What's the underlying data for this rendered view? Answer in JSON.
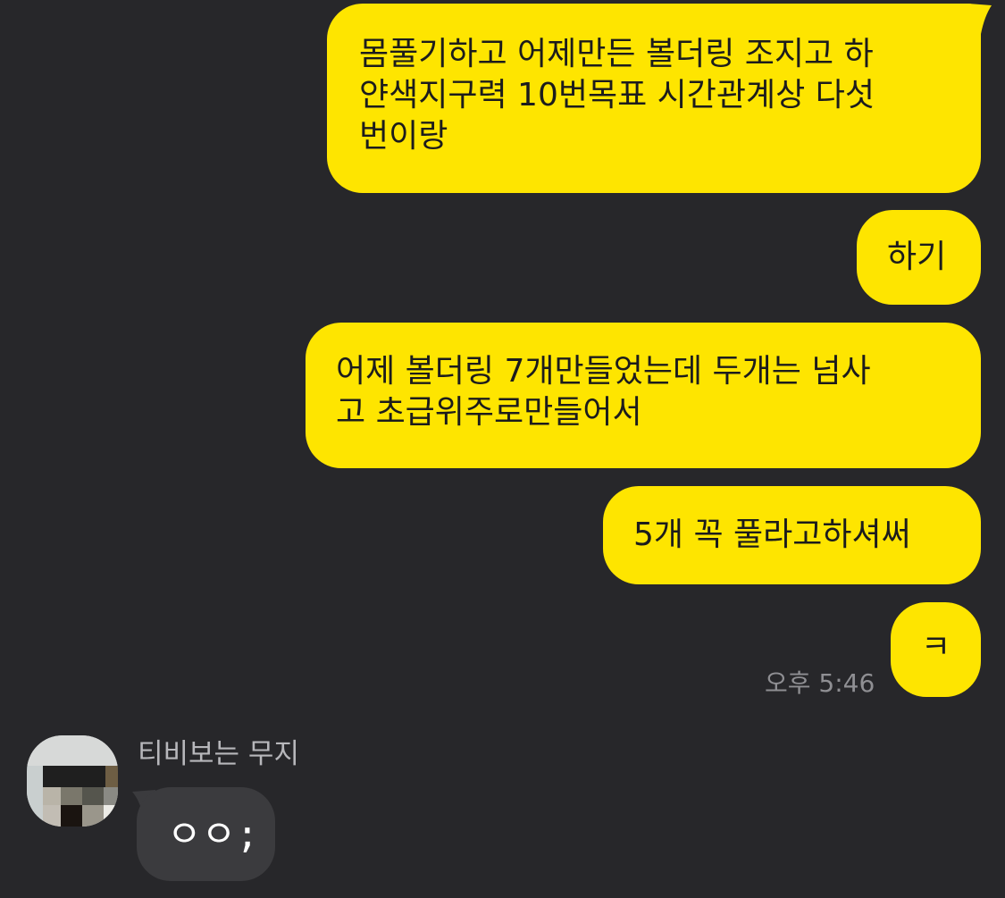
{
  "messages_out": [
    {
      "lines": [
        "몸풀기하고 어제만든 볼더링 조지고 하",
        "얀색지구력 10번목표 시간관계상 다섯",
        "번이랑"
      ]
    },
    {
      "lines": [
        "하기"
      ]
    },
    {
      "lines": [
        "어제 볼더링 7개만들었는데 두개는 넘사",
        "고 초급위주로만들어서"
      ]
    },
    {
      "lines": [
        "5개 꼭 풀라고하셔써"
      ]
    },
    {
      "lines": [
        "ㅋ"
      ],
      "time": "오후 5:46"
    }
  ],
  "incoming": {
    "sender": "티비보는 무지",
    "avatar_icon": "pixelated-profile-photo",
    "text": "ㅇㅇ;"
  },
  "colors": {
    "background": "#27272a",
    "outgoing_bubble": "#fee500",
    "incoming_bubble": "#3b3b3e"
  }
}
